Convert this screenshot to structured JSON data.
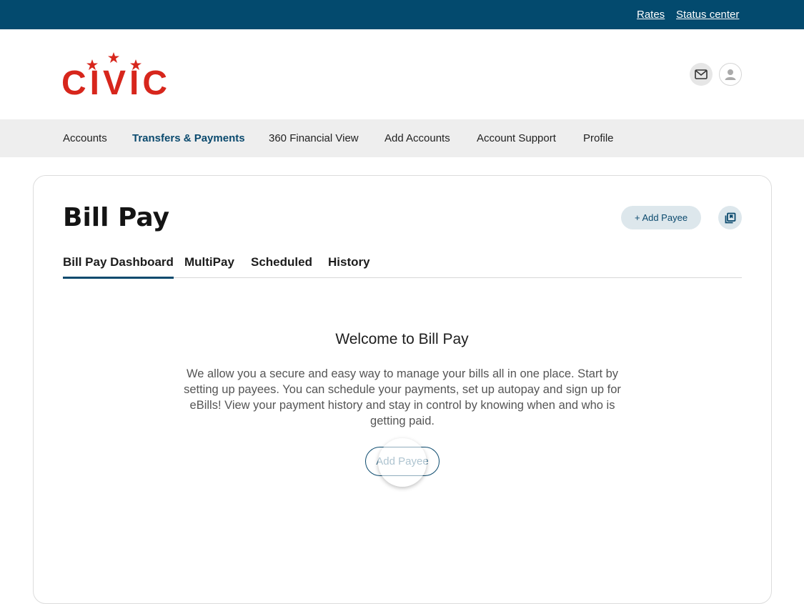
{
  "topbar": {
    "rates_label": "Rates",
    "status_label": "Status center",
    "background_color": "#034a6e"
  },
  "header": {
    "logo_text": "CIVIC",
    "logo_color": "#d7261c",
    "mail_icon": "mail-icon",
    "user_icon": "user-icon"
  },
  "nav": {
    "items": [
      {
        "label": "Accounts"
      },
      {
        "label": "Transfers & Payments",
        "active": true
      },
      {
        "label": "360 Financial View"
      },
      {
        "label": "Add Accounts"
      },
      {
        "label": "Account Support"
      },
      {
        "label": "Profile"
      }
    ]
  },
  "page": {
    "title": "Bill Pay",
    "add_payee_label": "+ Add Payee",
    "copy_icon": "copy-icon"
  },
  "tabs": [
    {
      "label": "Bill Pay Dashboard",
      "active": true
    },
    {
      "label": "MultiPay"
    },
    {
      "label": "Scheduled"
    },
    {
      "label": "History"
    }
  ],
  "welcome": {
    "title": "Welcome to Bill Pay",
    "body": "We allow you a secure and easy way to manage your bills all in one place. Start by setting up payees. You can schedule your payments, set up autopay and sign up for eBills! View your payment history and stay in control by knowing when and who is getting paid.",
    "button_label": "Add Payee"
  },
  "colors": {
    "accent": "#0b4a6e",
    "nav_background": "#eeeeee"
  }
}
